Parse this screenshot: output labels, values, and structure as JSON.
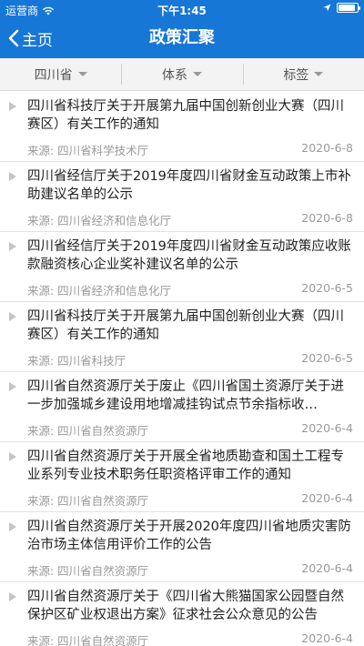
{
  "status": {
    "carrier": "运营商",
    "time": "下午1:45"
  },
  "nav": {
    "back_label": "主页",
    "title": "政策汇聚"
  },
  "filters": [
    {
      "label": "四川省"
    },
    {
      "label": "体系"
    },
    {
      "label": "标签"
    }
  ],
  "items": [
    {
      "title": "四川省科技厅关于开展第九届中国创新创业大赛（四川赛区）有关工作的通知",
      "source": "来源: 四川省科学技术厅",
      "date": "2020-6-8"
    },
    {
      "title": "四川省经信厅关于2019年度四川省财金互动政策上市补助建议名单的公示",
      "source": "来源: 四川省经济和信息化厅",
      "date": "2020-6-8"
    },
    {
      "title": "四川省经信厅关于2019年度四川省财金互动政策应收账款融资核心企业奖补建议名单的公示",
      "source": "来源: 四川省经济和信息化厅",
      "date": "2020-6-5"
    },
    {
      "title": "四川省科技厅关于开展第九届中国创新创业大赛（四川赛区）有关工作的通知",
      "source": "来源: 四川省科技厅",
      "date": "2020-6-5"
    },
    {
      "title": "四川省自然资源厅关于废止《四川省国土资源厅关于进一步加强城乡建设用地增减挂钩试点节余指标收…",
      "source": "来源: 四川省自然资源厅",
      "date": "2020-6-4"
    },
    {
      "title": "四川省自然资源厅关于开展全省地质勘查和国土工程专业系列专业技术职务任职资格评审工作的通知",
      "source": "来源: 四川省自然资源厅",
      "date": "2020-6-4"
    },
    {
      "title": "四川省自然资源厅关于开展2020年度四川省地质灾害防治市场主体信用评价工作的公告",
      "source": "来源: 四川省自然资源厅",
      "date": "2020-6-4"
    },
    {
      "title": "四川省自然资源厅关于《四川省大熊猫国家公园暨自然保护区矿业权退出方案》征求社会公众意见的公告",
      "source": "来源: 四川省自然资源厅",
      "date": "2020-6-4"
    }
  ]
}
